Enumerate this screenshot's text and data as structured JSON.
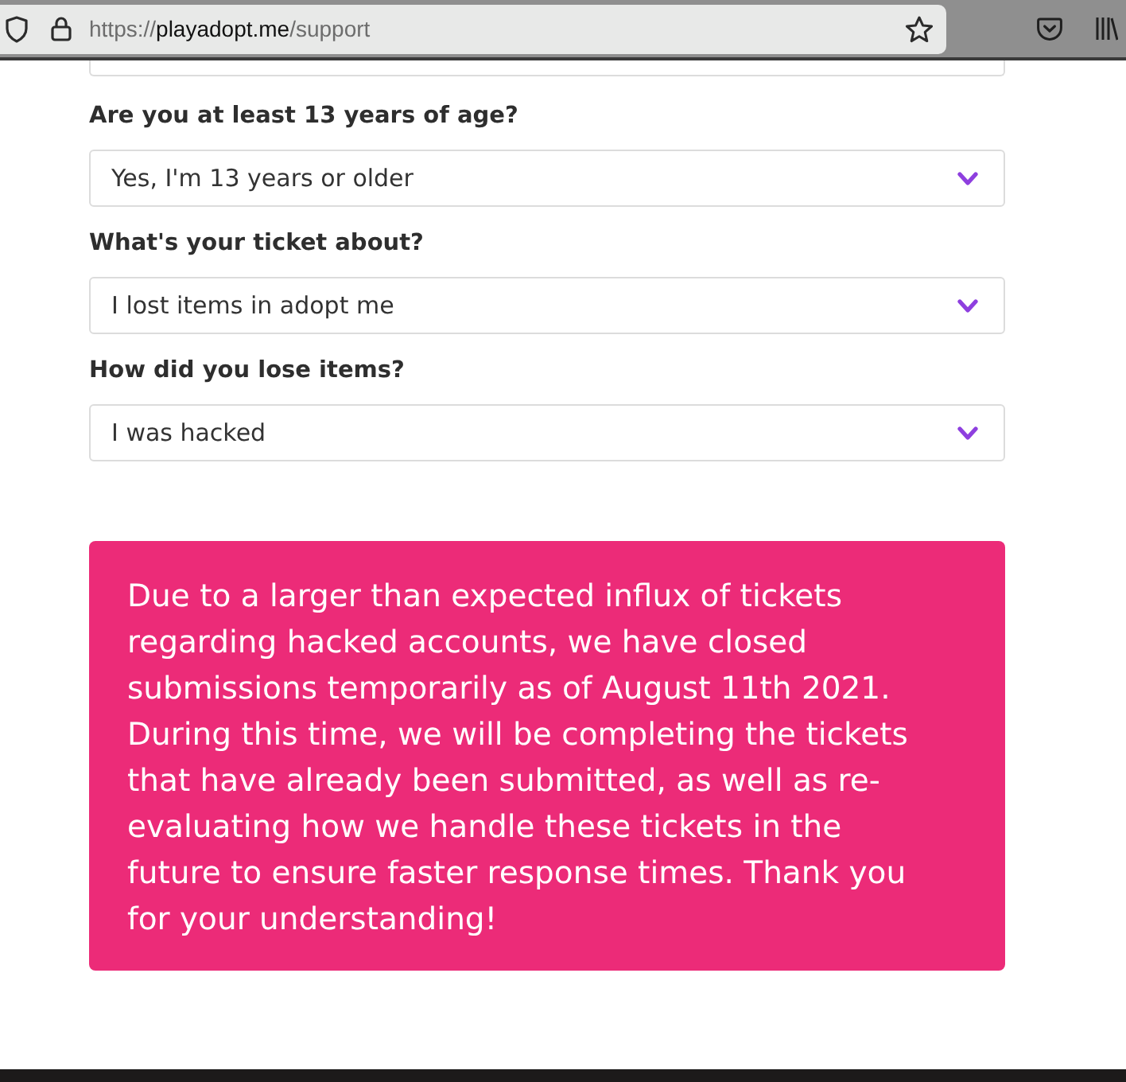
{
  "browser": {
    "url": {
      "scheme": "https://",
      "host": "playadopt.me",
      "path": "/support"
    }
  },
  "form": {
    "fields": [
      {
        "label": "Are you at least 13 years of age?",
        "value": "Yes, I'm 13 years or older"
      },
      {
        "label": "What's your ticket about?",
        "value": "I lost items in adopt me"
      },
      {
        "label": "How did you lose items?",
        "value": "I was hacked"
      }
    ]
  },
  "notice": {
    "text": "Due to a larger than expected influx of tickets regarding hacked accounts, we have closed submissions temporarily as of August 11th 2021. During this time, we will be completing the tickets that have already been submitted, as well as re-evaluating how we handle these tickets in the future to ensure faster response times. Thank you for your understanding!"
  }
}
